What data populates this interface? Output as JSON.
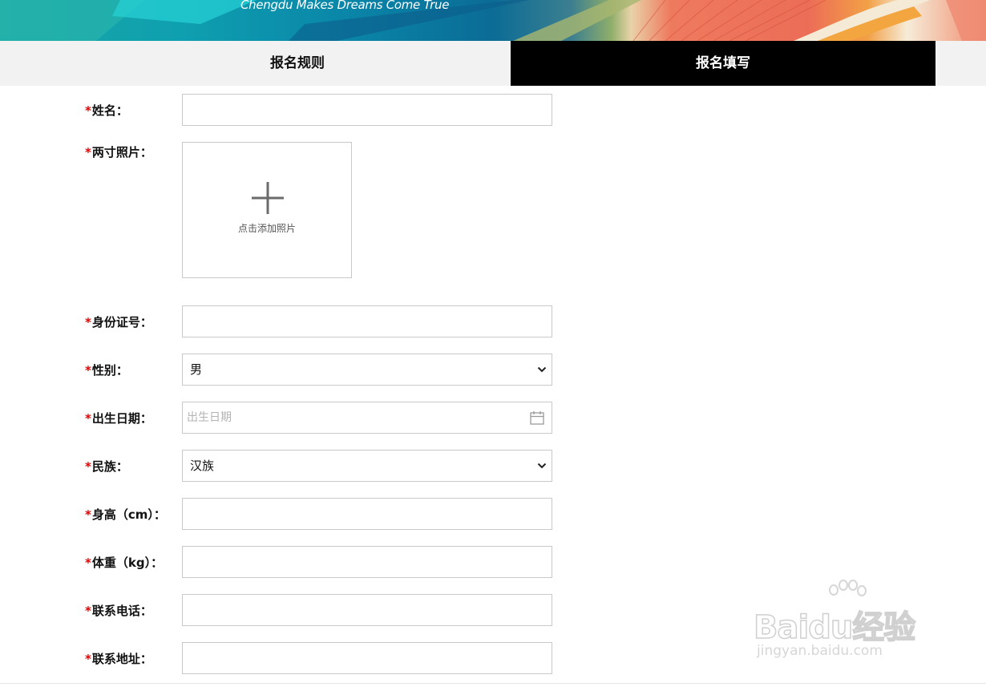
{
  "banner": {
    "slogan": "Chengdu Makes Dreams Come True"
  },
  "tabs": [
    {
      "label": "报名规则",
      "active": false
    },
    {
      "label": "报名填写",
      "active": true
    }
  ],
  "form": {
    "required_mark": "*",
    "name": {
      "label": "姓名：",
      "value": ""
    },
    "photo": {
      "label": "两寸照片：",
      "hint": "点击添加照片"
    },
    "id_number": {
      "label": "身份证号：",
      "value": ""
    },
    "gender": {
      "label": "性别：",
      "selected": "男"
    },
    "birth_date": {
      "label": "出生日期：",
      "placeholder": "出生日期"
    },
    "ethnicity": {
      "label": "民族：",
      "selected": "汉族"
    },
    "height": {
      "label": "身高（cm）：",
      "value": ""
    },
    "weight": {
      "label": "体重（kg）：",
      "value": ""
    },
    "phone": {
      "label": "联系电话：",
      "value": ""
    },
    "address": {
      "label": "联系地址：",
      "value": ""
    }
  },
  "watermark": {
    "brand": "Baidu经验",
    "url": "jingyan.baidu.com"
  },
  "colors": {
    "required": "#e00000",
    "active_tab_bg": "#000000",
    "tab_bar_bg": "#f2f2f2",
    "field_border": "#c9c9c9"
  },
  "icons": {
    "photo_add": "plus-icon",
    "date": "calendar-icon",
    "select": "chevron-down-icon"
  }
}
